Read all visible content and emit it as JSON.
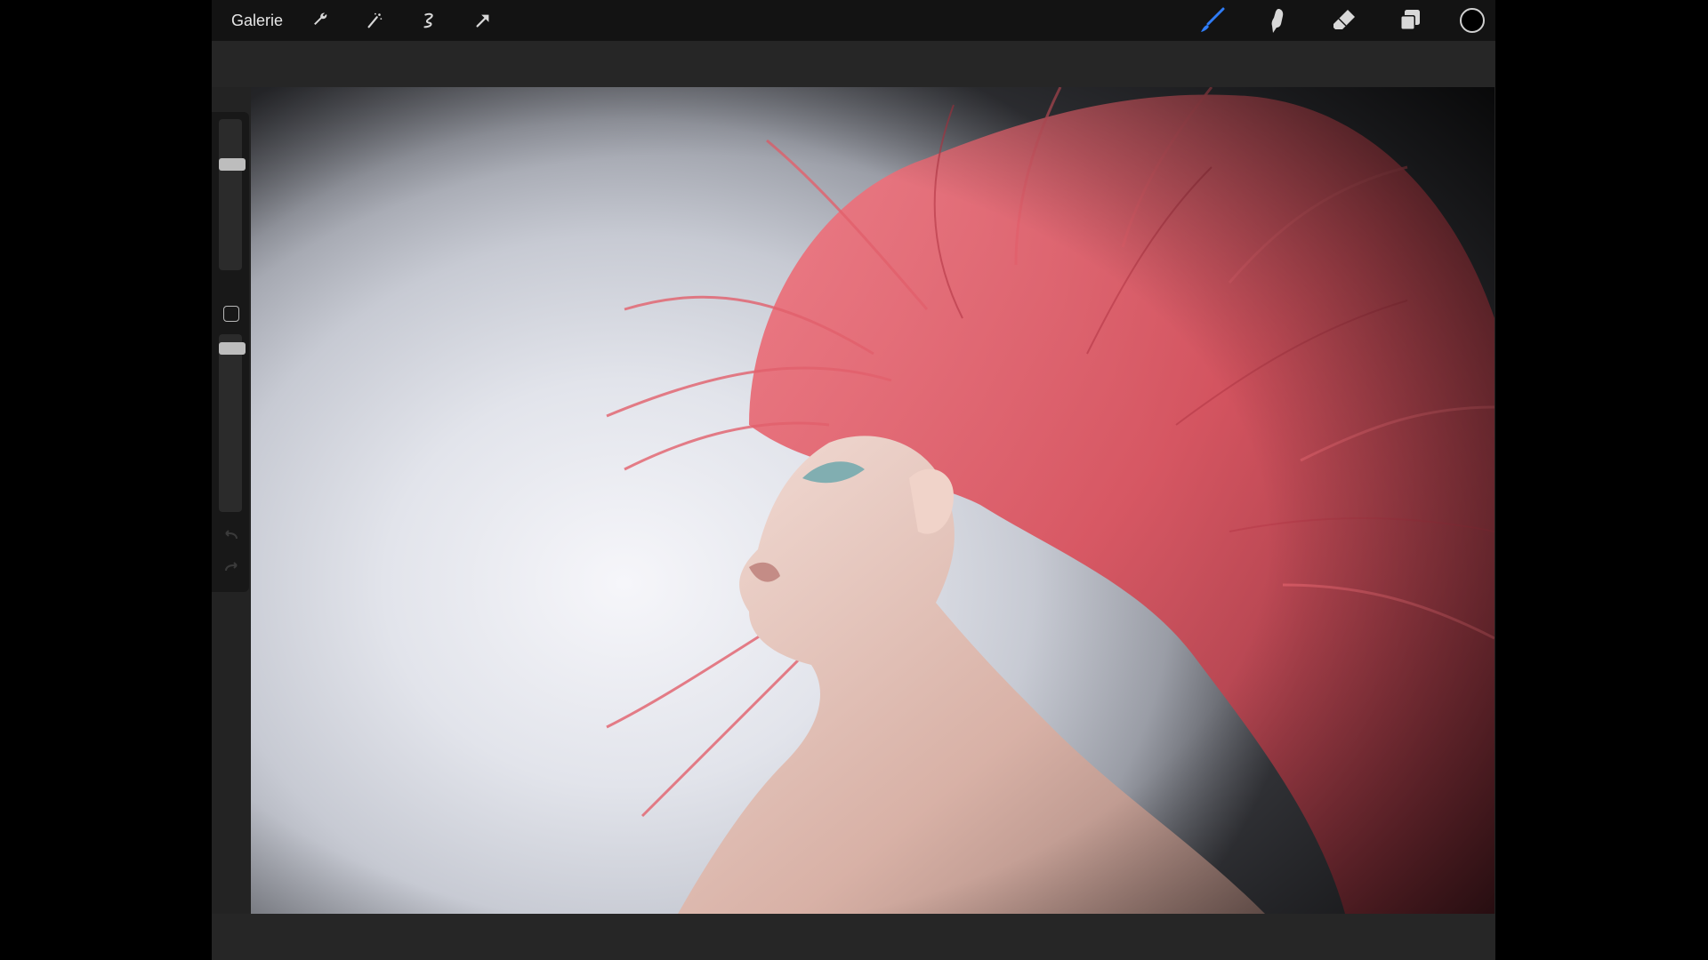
{
  "toolbar": {
    "gallery_label": "Galerie",
    "left_tools": [
      {
        "name": "wrench-icon"
      },
      {
        "name": "magic-wand-icon"
      },
      {
        "name": "selection-icon"
      },
      {
        "name": "transform-arrow-icon"
      }
    ],
    "right_tools": [
      {
        "name": "brush-icon",
        "color": "#2f7cf6",
        "active": true
      },
      {
        "name": "smudge-icon",
        "color": "#d8d8d8",
        "active": false
      },
      {
        "name": "eraser-icon",
        "color": "#d8d8d8",
        "active": false
      },
      {
        "name": "layers-icon",
        "color": "#d8d8d8",
        "active": false
      }
    ],
    "current_color": "#000000"
  },
  "sidebar": {
    "brush_size_level": 0.72,
    "brush_opacity_level": 0.95
  },
  "colors": {
    "accent": "#2f7cf6",
    "hair": "#e0606c"
  }
}
